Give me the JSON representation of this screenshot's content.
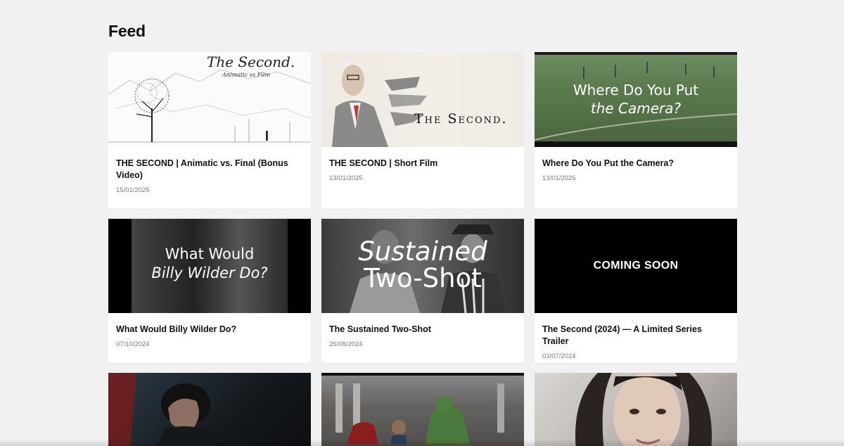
{
  "page": {
    "title": "Feed"
  },
  "feed": {
    "items": [
      {
        "title": "THE SECOND | Animatic vs. Final (Bonus Video)",
        "date": "15/01/2025",
        "thumb": {
          "line1": "The Second.",
          "line2": "Animatic vs Film"
        }
      },
      {
        "title": "THE SECOND | Short Film",
        "date": "13/01/2025",
        "thumb": {
          "line1": "The Second."
        }
      },
      {
        "title": "Where Do You Put the Camera?",
        "date": "13/01/2025",
        "thumb": {
          "line1": "Where Do You Put",
          "line2": "the Camera?"
        }
      },
      {
        "title": "What Would Billy Wilder Do?",
        "date": "07/10/2024",
        "thumb": {
          "line1": "What Would",
          "line2": "Billy Wilder Do?"
        }
      },
      {
        "title": "The Sustained Two-Shot",
        "date": "26/08/2024",
        "thumb": {
          "line1": "Sustained",
          "line2": "Two-Shot"
        }
      },
      {
        "title": "The Second (2024) — A Limited Series Trailer",
        "date": "03/07/2024",
        "thumb": {
          "line1": "COMING SOON"
        }
      },
      {
        "title": "",
        "date": "",
        "thumb": {}
      },
      {
        "title": "",
        "date": "",
        "thumb": {}
      },
      {
        "title": "",
        "date": "",
        "thumb": {}
      }
    ]
  }
}
